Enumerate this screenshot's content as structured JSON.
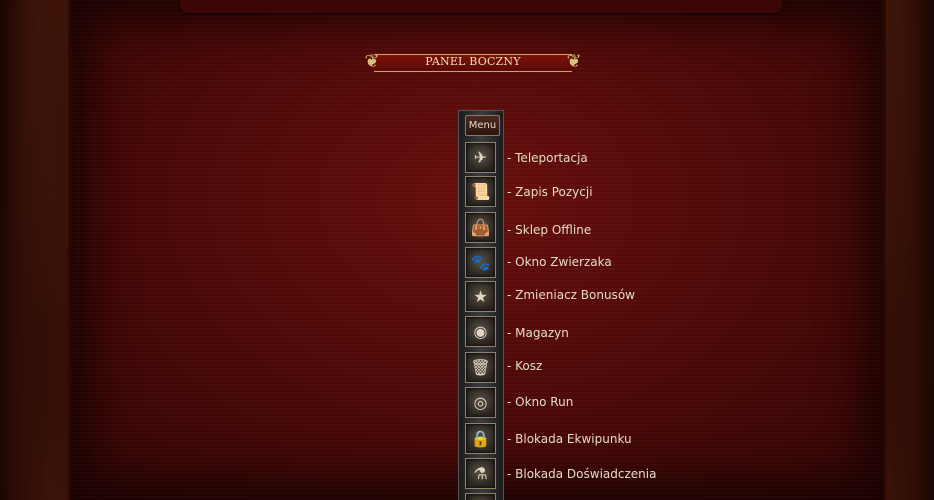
{
  "panel": {
    "title": "PANEL BOCZNY",
    "menu_label": "Menu"
  },
  "items": [
    {
      "label": "- Teleportacja",
      "icon": "teleport-scroll-icon"
    },
    {
      "label": "- Zapis Pozycji",
      "icon": "position-scroll-icon"
    },
    {
      "label": "- Sklep Offline",
      "icon": "bag-icon"
    },
    {
      "label": "- Okno Zwierzaka",
      "icon": "paw-icon"
    },
    {
      "label": "- Zmieniacz Bonusów",
      "icon": "star-bonus-icon"
    },
    {
      "label": "- Magazyn",
      "icon": "warehouse-orb-icon"
    },
    {
      "label": "- Kosz",
      "icon": "trash-icon"
    },
    {
      "label": "- Okno Run",
      "icon": "rune-eye-icon"
    },
    {
      "label": "- Blokada Ekwipunku",
      "icon": "equipment-lock-icon"
    },
    {
      "label": "- Blokada Doświadczenia",
      "icon": "experience-lock-icon"
    }
  ],
  "colors": {
    "background": "#4a0807",
    "text": "#e6dcc4",
    "gold": "#c9a85a"
  }
}
